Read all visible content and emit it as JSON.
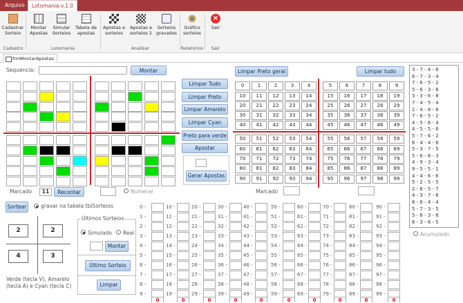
{
  "tabs": {
    "file": "Arquivo",
    "app": "Lotomania v.1.0"
  },
  "ribbon": {
    "cadastrar": "Cadastrar Sorteio",
    "montar": "Montar Apostas",
    "simular": "Simular Sorteios",
    "tabela": "Tabela de apostas",
    "apostas_sorteios": "Apostas e sorteios",
    "apostas_sorteios2": "Apostas e sorteios 2",
    "sorteios_gravados": "Sorteios gravados",
    "grafico": "Gráfico sorteios",
    "sair": "Sair",
    "groups": {
      "cadastro": "Cadastro",
      "lotomania": "Lotomania",
      "analisar": "Analisar",
      "relatorios": "Relatórios",
      "sair": "Sair"
    }
  },
  "doc_tab": "frmMontarApostas",
  "form": {
    "sequencia_label": "Sequencia:",
    "montar_btn": "Montar",
    "limpar_preto_geral": "Limpar Preto geral",
    "limpar_tudo_top": "Limpar tudo",
    "limpar_tudo": "Limpar Tudo",
    "limpar_preto": "Limpar Preto",
    "limpar_amarelo": "Limpar Amarelo",
    "limpar_cyan": "Limpar Cyan",
    "preto_para_verde": "Preto para verde",
    "apostar": "Apostar",
    "gerar_apostas": "Gerar Apostas",
    "marcado_label": "Marcado",
    "marcado_value": "11",
    "recontar": "Recontar",
    "numerar": "Numerar",
    "marcado_label2": "Marcado",
    "sortear": "Sortear",
    "gravar": "gravar na tabela tblSorteios",
    "ultimos_sorteios": "Últimos Sorteios",
    "simulado": "Simulado",
    "real": "Real",
    "montar2": "Montar",
    "ultimo_sorteio": "Último Sorteio",
    "limpar": "Limpar",
    "quad": [
      "2",
      "2",
      "4",
      "3"
    ],
    "legend": "Verde (tecla V), Amarelo (tecla A) e Cyan (tecla C)",
    "acumulado": "Acumulado",
    "numbers": [
      "0",
      "1",
      "2",
      "3",
      "4",
      "5",
      "6",
      "7",
      "8",
      "9",
      "10",
      "11",
      "12",
      "13",
      "14",
      "15",
      "16",
      "17",
      "18",
      "19",
      "20",
      "21",
      "22",
      "23",
      "24",
      "25",
      "26",
      "27",
      "28",
      "29",
      "30",
      "31",
      "32",
      "33",
      "34",
      "35",
      "36",
      "37",
      "38",
      "39",
      "40",
      "41",
      "42",
      "43",
      "44",
      "45",
      "46",
      "47",
      "48",
      "49",
      "50",
      "51",
      "52",
      "53",
      "54",
      "55",
      "56",
      "57",
      "58",
      "59",
      "60",
      "61",
      "62",
      "63",
      "64",
      "65",
      "66",
      "67",
      "68",
      "69",
      "70",
      "71",
      "72",
      "73",
      "74",
      "75",
      "76",
      "77",
      "78",
      "79",
      "80",
      "81",
      "82",
      "83",
      "84",
      "85",
      "86",
      "87",
      "88",
      "89",
      "90",
      "91",
      "92",
      "93",
      "94",
      "95",
      "96",
      "97",
      "98",
      "99"
    ],
    "hist_labels": [
      "0 -",
      "1 -",
      "2 -",
      "3 -",
      "4 -",
      "5 -",
      "6 -",
      "7 -",
      "8 -",
      "9 -",
      "10 -",
      "11 -",
      "12 -",
      "13 -",
      "14 -",
      "15 -",
      "16 -",
      "17 -",
      "18 -",
      "19 -",
      "20 -",
      "21 -",
      "22 -",
      "23 -",
      "24 -",
      "25 -",
      "26 -",
      "27 -",
      "28 -",
      "29 -",
      "30 -",
      "31 -",
      "32 -",
      "33 -",
      "34 -",
      "35 -",
      "36 -",
      "37 -",
      "38 -",
      "39 -",
      "40 -",
      "41 -",
      "42 -",
      "43 -",
      "44 -",
      "45 -",
      "46 -",
      "47 -",
      "48 -",
      "49 -",
      "50 -",
      "51 -",
      "52 -",
      "53 -",
      "54 -",
      "55 -",
      "56 -",
      "57 -",
      "58 -",
      "59 -",
      "60 -",
      "61 -",
      "62 -",
      "63 -",
      "64 -",
      "65 -",
      "66 -",
      "67 -",
      "68 -",
      "69 -",
      "70 -",
      "71 -",
      "72 -",
      "73 -",
      "74 -",
      "75 -",
      "76 -",
      "77 -",
      "78 -",
      "79 -",
      "80 -",
      "81 -",
      "82 -",
      "83 -",
      "84 -",
      "85 -",
      "86 -",
      "87 -",
      "88 -",
      "89 -",
      "90 -",
      "91 -",
      "92 -",
      "93 -",
      "94 -",
      "95 -",
      "96 -",
      "97 -",
      "98 -",
      "99 -"
    ],
    "zero": "0",
    "list": [
      "3 - 7 - 4 - 6",
      "6 - 7 - 3 - 4",
      "7 - 6 - 5 - 2",
      "5 - 6 - 3 - 6",
      "3 - 3 - 6 - 8",
      "7 - 4 - 5 - 4",
      "2 - 4 - 8 - 6",
      "7 - 6 - 5 - 2",
      "4 - 5 - 6 - 4",
      "4 - 5 - 5 - 6",
      "5 - 7 - 6 - 2",
      "6 - 4 - 4 - 6",
      "5 - 3 - 7 - 5",
      "5 - 6 - 6 - 3",
      "4 - 9 - 3 - 4",
      "9 - 5 - 5 - 1",
      "4 - 4 - 6 - 6",
      "5 - 2 - 5 - 5",
      "2 - 6 - 5 - 7",
      "4 - 3 - 7 - 6",
      "6 - 6 - 4 - 4",
      "5 - 7 - 3 - 5",
      "5 - 6 - 3 - 6",
      "6 - 3 - 6 - 5"
    ]
  },
  "grid_colors": {
    "green": "#00dd00",
    "yellow": "#ffff00",
    "black": "#000000",
    "cyan": "#00ffff"
  },
  "grid_marks": [
    {
      "r": 1,
      "c": 2,
      "color": "y"
    },
    {
      "r": 2,
      "c": 1,
      "color": "g"
    },
    {
      "r": 3,
      "c": 2,
      "color": "g"
    },
    {
      "r": 3,
      "c": 3,
      "color": "y"
    },
    {
      "r": 1,
      "c": 7,
      "color": "g"
    },
    {
      "r": 2,
      "c": 5,
      "color": "g"
    },
    {
      "r": 2,
      "c": 8,
      "color": "y"
    },
    {
      "r": 4,
      "c": 6,
      "color": "k"
    },
    {
      "r": 5,
      "c": 9,
      "color": "g"
    },
    {
      "r": 6,
      "c": 1,
      "color": "g"
    },
    {
      "r": 6,
      "c": 2,
      "color": "k"
    },
    {
      "r": 6,
      "c": 3,
      "color": "k"
    },
    {
      "r": 6,
      "c": 6,
      "color": "k"
    },
    {
      "r": 6,
      "c": 7,
      "color": "k"
    },
    {
      "r": 7,
      "c": 2,
      "color": "g"
    },
    {
      "r": 7,
      "c": 4,
      "color": "c"
    },
    {
      "r": 7,
      "c": 5,
      "color": "y"
    },
    {
      "r": 7,
      "c": 8,
      "color": "g"
    },
    {
      "r": 8,
      "c": 3,
      "color": "g"
    },
    {
      "r": 8,
      "c": 8,
      "color": "g"
    }
  ]
}
